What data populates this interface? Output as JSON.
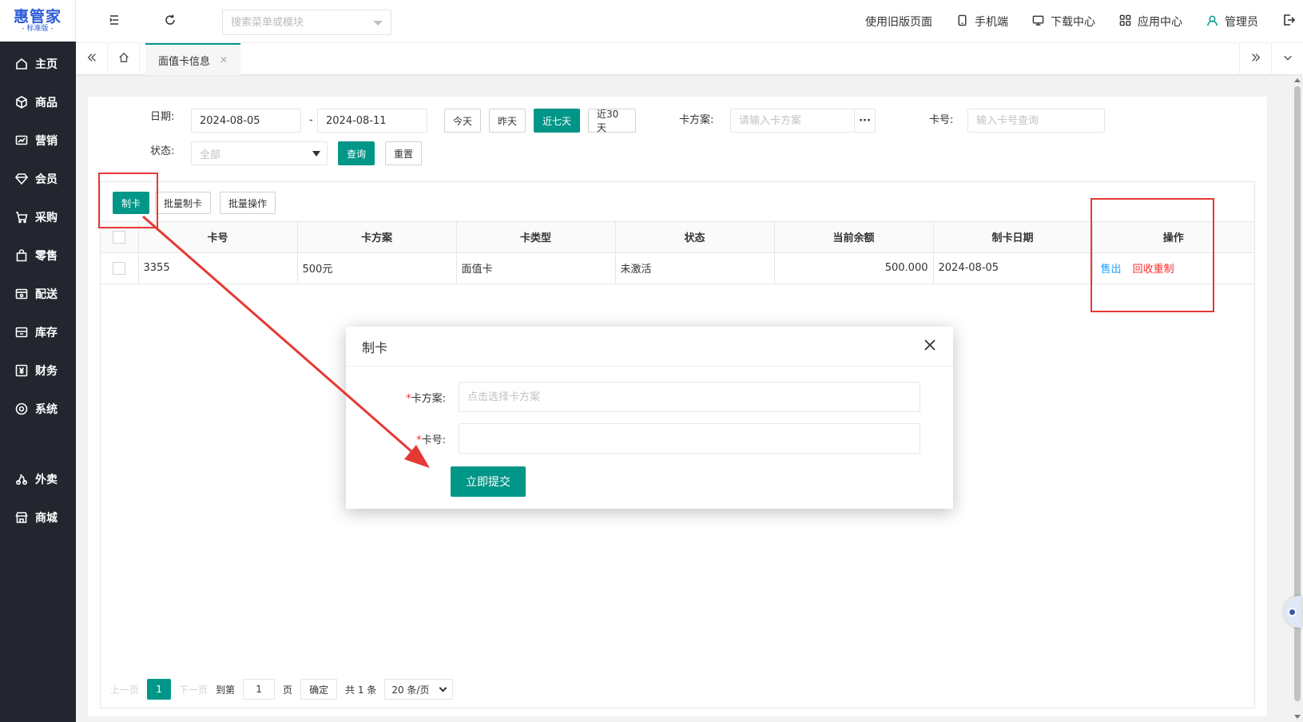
{
  "brand": {
    "name": "惠管家",
    "edition": "- 标准版 -",
    "color": "#2b5bd7"
  },
  "sidebar": {
    "items": [
      {
        "label": "主页",
        "icon": "home-icon"
      },
      {
        "label": "商品",
        "icon": "cube-icon"
      },
      {
        "label": "营销",
        "icon": "chart-icon"
      },
      {
        "label": "会员",
        "icon": "diamond-icon"
      },
      {
        "label": "采购",
        "icon": "cart-icon"
      },
      {
        "label": "零售",
        "icon": "bag-icon"
      },
      {
        "label": "配送",
        "icon": "truck-icon"
      },
      {
        "label": "库存",
        "icon": "box-icon"
      },
      {
        "label": "财务",
        "icon": "yen-icon"
      },
      {
        "label": "系统",
        "icon": "settings-icon"
      }
    ],
    "extra_items": [
      {
        "label": "外卖",
        "icon": "takeout-icon"
      },
      {
        "label": "商城",
        "icon": "shop-icon"
      }
    ]
  },
  "header": {
    "search_placeholder": "搜索菜单或模块",
    "links": {
      "old_version": "使用旧版页面",
      "mobile": "手机端",
      "download": "下载中心",
      "apps": "应用中心",
      "user": "管理员"
    }
  },
  "tabs": {
    "active": "面值卡信息"
  },
  "filters": {
    "date_label": "日期:",
    "date_from": "2024-08-05",
    "date_sep": "-",
    "date_to": "2024-08-11",
    "quick": {
      "today": "今天",
      "yesterday": "昨天",
      "week": "近七天",
      "month": "近30天"
    },
    "plan_label": "卡方案:",
    "plan_placeholder": "请输入卡方案",
    "plan_more": "···",
    "card_label": "卡号:",
    "card_placeholder": "输入卡号查询",
    "status_label": "状态:",
    "status_value": "全部",
    "query": "查询",
    "reset": "重置"
  },
  "toolbar": {
    "make_card": "制卡",
    "batch_make": "批量制卡",
    "batch_ops": "批量操作"
  },
  "table": {
    "columns": [
      "卡号",
      "卡方案",
      "卡类型",
      "状态",
      "当前余额",
      "制卡日期",
      "操作"
    ],
    "rows": [
      {
        "card_no": "3355",
        "plan": "500元",
        "type": "面值卡",
        "status": "未激活",
        "balance": "500.000",
        "date": "2024-08-05",
        "op_sell": "售出",
        "op_recycle": "回收重制"
      }
    ]
  },
  "pager": {
    "prev": "上一页",
    "current": "1",
    "next": "下一页",
    "goto": "到第",
    "page_input": "1",
    "page_unit": "页",
    "confirm": "确定",
    "total": "共 1 条",
    "page_size": "20 条/页"
  },
  "modal": {
    "title": "制卡",
    "plan_label": "卡方案:",
    "plan_placeholder": "点击选择卡方案",
    "card_label": "卡号:",
    "required_mark": "*",
    "submit": "立即提交"
  },
  "colors": {
    "primary": "#009688",
    "sidebar": "#23262e",
    "annotation": "#e53935",
    "link": "#1e9fff",
    "danger": "#ff2a2a"
  }
}
